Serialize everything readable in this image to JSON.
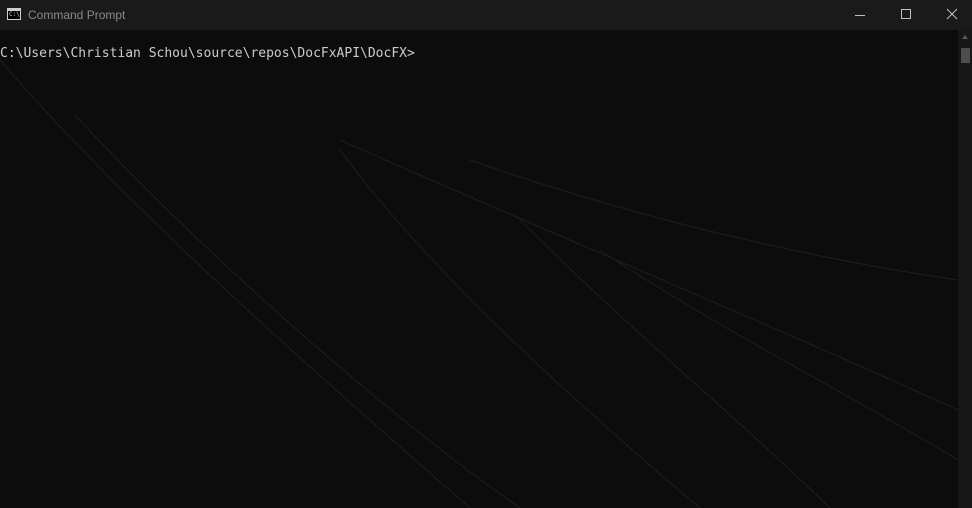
{
  "window": {
    "title": "Command Prompt",
    "app_icon_glyph": "C:\\"
  },
  "console": {
    "prompt": "C:\\Users\\Christian Schou\\source\\repos\\DocFxAPI\\DocFX>"
  },
  "colors": {
    "titlebar_bg": "#1a1a1a",
    "console_bg": "#0c0c0c",
    "console_text": "#cccccc",
    "title_text": "#8a8a8a"
  },
  "icons": {
    "minimize": "minimize-icon",
    "maximize": "maximize-icon",
    "close": "close-icon",
    "scroll_up": "scroll-up-arrow-icon"
  }
}
